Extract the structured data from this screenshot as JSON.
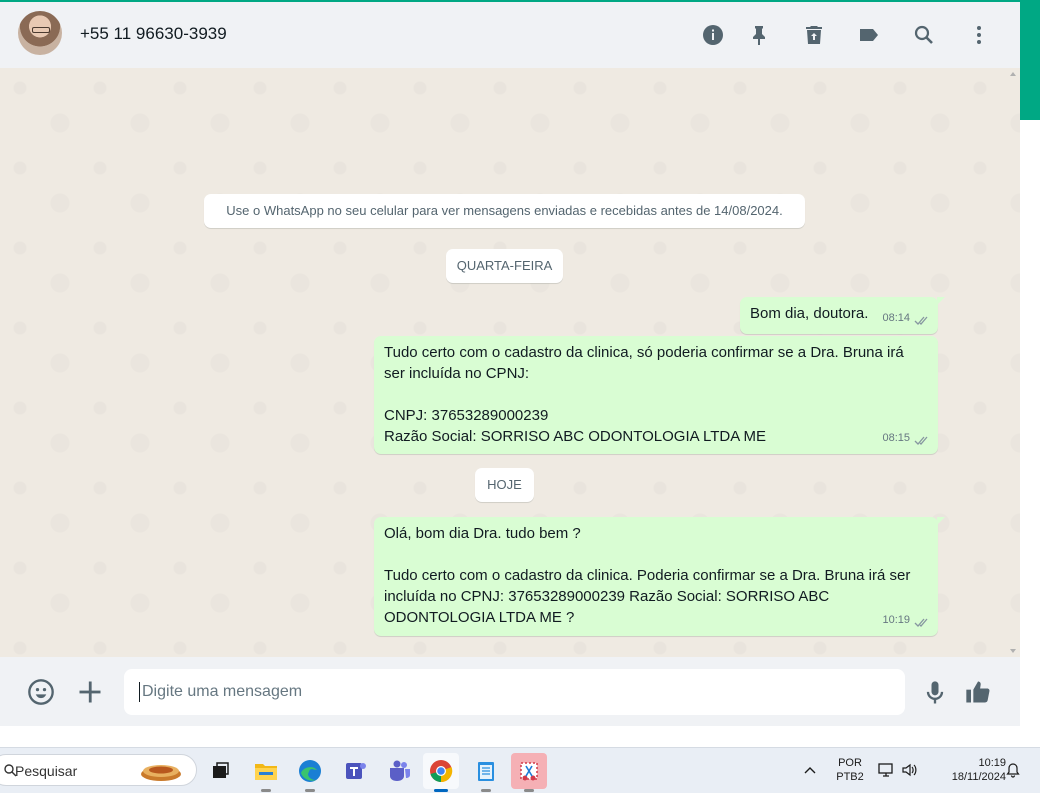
{
  "header": {
    "contact_name": "+55 11 96630-3939",
    "icons": [
      "info-icon",
      "pin-icon",
      "delete-icon",
      "label-icon",
      "search-icon",
      "menu-icon"
    ]
  },
  "notice": "Use o WhatsApp no seu celular para ver mensagens enviadas e recebidas antes de 14/08/2024.",
  "dates": {
    "first": "QUARTA-FEIRA",
    "second": "HOJE"
  },
  "messages": [
    {
      "text": "Bom dia, doutora.",
      "time": "08:14"
    },
    {
      "text": "Tudo certo com o cadastro da clinica, só poderia confirmar se a Dra. Bruna irá ser incluída no CPNJ:\n\nCNPJ: 37653289000239\nRazão Social: SORRISO ABC ODONTOLOGIA LTDA ME",
      "time": "08:15"
    },
    {
      "text": "Olá, bom dia Dra. tudo bem ?\n\nTudo certo com o cadastro da clinica. Poderia confirmar se a Dra. Bruna irá ser incluída no CPNJ: 37653289000239 Razão Social: SORRISO ABC ODONTOLOGIA LTDA ME ?",
      "time": "10:19"
    }
  ],
  "composer": {
    "placeholder": "Digite uma mensagem"
  },
  "taskbar": {
    "search_label": "Pesquisar",
    "language": "POR",
    "layout": "PTB2",
    "time": "10:19",
    "date": "18/11/2024"
  },
  "colors": {
    "accent": "#00a884",
    "bubble_out": "#d9fdd3",
    "chat_bg": "#efeae2",
    "header_bg": "#f0f2f5"
  }
}
